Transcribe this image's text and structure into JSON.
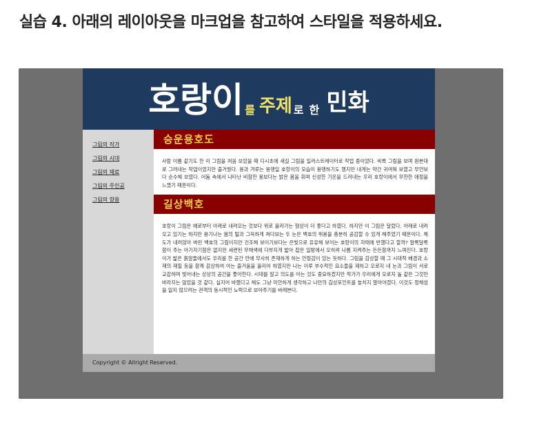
{
  "instruction": "실습 4. 아래의 레이아웃을 마크업을 참고하여 스타일을 적용하세요.",
  "banner": {
    "part1": "호랑이",
    "part2": "를",
    "part3": "주제",
    "part4": "로",
    "part5": "한",
    "part6": "민화"
  },
  "nav": {
    "items": [
      "그림의 작가",
      "그림의 시대",
      "그림의 재료",
      "그림의 주인공",
      "그림의 향용"
    ]
  },
  "sections": [
    {
      "title": "승운용호도",
      "body": "사람 이름 같기도 한 이 그림을 처음 보았을 때 디시초에 새길 그림을 일러스트레이터로 작업 중이었다. 비록 그림을 보며 원본대로 그려내는 작업이었지만 즐거웠다. 용과 겨루는 용맹일 호랑이의 모습이 용맹하기도 했지만 내게는 약간 귀여워 보였고 무언보다 순수해 보였다. 어둠 속에서 나타난 비참한 용보다는 밝은 몸을 휘며 신성한 기운을 드러내는 우리 호랑이에서 무한한 애정을 느꼈기 때문이다."
    },
    {
      "title": "길상백호",
      "body": "호랑이 그림은 예로부터 아래로 내려오는 것보다 위로 올라가는 형상이 더 좋다고 하였다. 하지만 이 그림은 달랐다. 아래로 내려오고 있기는 하지만 용기나는 몸의 털과 그윽하게 쳐다보는 두 눈은 백호의 위용을 충분히 공감할 수 있게 해주었기 때문이다. 체도가 내려앉아 버린 백호의 그림이지만 건조해 보이기보다는 은빛으로 유유해 보이는 호랑이의 자태에 반했다고 할까? 알록달록함이 주는 아기자기함은 없지만 세련된 무채색에 다부지게 밟아 잡은 일방에서 오히려 나름 지켜주는 든든함까지 느껴진다. 호랑이가 밟은 흙알들에서도 우리를 한 공간 안에 무사히 존재하게 하는 안정감이 있는 듯하다. 그림을 감상할 때 그 시대적 배경과 소재의 재질 등을 함께 감상하여 아는 즐거움을 올리어 하였지만 나는 이루 부수적인 요소들을 제하고 오로지 내 눈과 그림이 서로 교감하며 빛어내는 상상의 공간을 좋아한다. 시대를 알고 의도를 아는 것도 중요하겠지만 작가가 우리에게 오로지 높 같은 그것만 바라지는 않았을 것 같다. 실지어 바랬다고 해도 그냥 미안하게 생각하고 나만의 감상포인트를 놓치지 말아야겠다. 이것도 정체성을 잃지 않으려는 관객의 동시적인 노력으로 보아주기를 바래본다."
    }
  ],
  "footer": {
    "text": "Copyright © Allright Reserved."
  }
}
